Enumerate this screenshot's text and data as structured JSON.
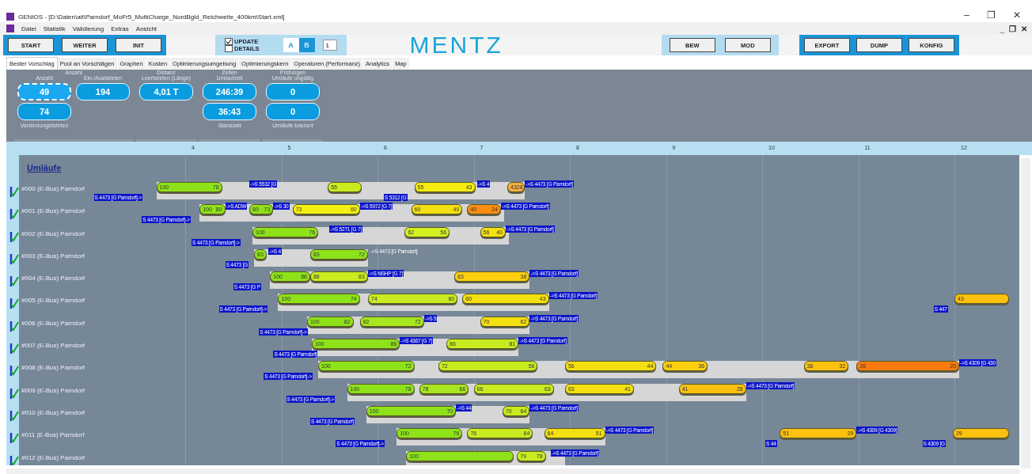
{
  "window": {
    "title": "GENIOS - [D:\\Daten\\ait\\Parndorf_MoFr5_MultiCharge_NordBgld_Reichweite_400km\\Start.xml]",
    "controls": [
      "–",
      "❐",
      "✕"
    ]
  },
  "menu": {
    "items": [
      "Datei",
      "Statistik",
      "Validierung",
      "Extras",
      "Ansicht"
    ],
    "controls": [
      "_",
      "❐",
      "✕"
    ]
  },
  "toolbar": {
    "left_buttons": [
      "START",
      "WEITER",
      "INIT"
    ],
    "checkboxes": [
      {
        "label": "UPDATE",
        "checked": true
      },
      {
        "label": "DETAILS",
        "checked": false
      }
    ],
    "toggle": [
      {
        "label": "A",
        "selected": false
      },
      {
        "label": "B",
        "selected": true
      }
    ],
    "spinner": "1",
    "logo": "MENTZ",
    "mid_buttons": [
      "BEW",
      "MOD"
    ],
    "right_buttons": [
      "EXPORT",
      "DUMP",
      "KONFIG"
    ]
  },
  "tabs": [
    {
      "label": "Bester Vorschlag",
      "selected": true
    },
    {
      "label": "Pool an Vorschlägen",
      "selected": false
    },
    {
      "label": "Graphen",
      "selected": false
    },
    {
      "label": "Kosten",
      "selected": false
    },
    {
      "label": "Optimierungsumgebung",
      "selected": false
    },
    {
      "label": "Optimierungskern",
      "selected": false
    },
    {
      "label": "Operatoren (Performanz)",
      "selected": false
    },
    {
      "label": "Analytics",
      "selected": false
    },
    {
      "label": "Map",
      "selected": false
    }
  ],
  "stats": [
    {
      "title": "Anzahl",
      "columns": [
        {
          "label": "Anzahl",
          "cards": [
            {
              "value": "49",
              "selected": true
            },
            {
              "value": "74",
              "selected": false
            }
          ],
          "caption": "Verbindungsfahrten"
        },
        {
          "label": "Ein-/Ausfahrten",
          "cards": [
            {
              "value": "194",
              "selected": false
            }
          ]
        }
      ]
    },
    {
      "title": "Distanz",
      "columns": [
        {
          "label": "Leerfahrten (Länge)",
          "cards": [
            {
              "value": "4,01 T",
              "selected": false
            }
          ]
        }
      ]
    },
    {
      "title": "Zeiten",
      "columns": [
        {
          "label": "Umlaufzeit",
          "cards": [
            {
              "value": "246:39",
              "selected": false
            },
            {
              "value": "36:43",
              "selected": false
            }
          ],
          "caption": "Standzeit"
        }
      ]
    },
    {
      "title": "Prüfungen",
      "columns": [
        {
          "label": "Umläufe ungültig",
          "cards": [
            {
              "value": "0",
              "selected": false
            },
            {
              "value": "0",
              "selected": false
            }
          ],
          "caption": "Umläufe toleriert"
        }
      ]
    }
  ],
  "timeline": {
    "hours": [
      "4",
      "5",
      "6",
      "7",
      "8",
      "9",
      "10",
      "11",
      "12"
    ]
  },
  "gantt": {
    "title": "Umläufe",
    "rows": [
      {
        "label": "#000 (E-Bus) Parndorf",
        "bars": [
          {
            "color": "#8ee21a",
            "from": "100",
            "to": "78"
          },
          {
            "color": "#c8ec20",
            "from": "55"
          },
          {
            "color": "#f4ec10",
            "from": "55",
            "to": "43"
          },
          {
            "color": "#f5b040",
            "from": "43",
            "to": "28"
          }
        ],
        "tags": [
          {
            "text": "S 4473 [G Parndorf]->",
            "kind": "blue"
          },
          {
            "text": "->S 5532 [G",
            "kind": "blue"
          },
          {
            "text": "S 5312 [G",
            "kind": "blue"
          },
          {
            "text": "->S 4",
            "kind": "blue"
          },
          {
            "text": "->S 4473 [G Parndorf]",
            "kind": "blue"
          }
        ]
      },
      {
        "label": "#001 (E-Bus) Parndorf",
        "bars": [
          {
            "color": "#8ee21a",
            "from": "100",
            "to": "80"
          },
          {
            "color": "#8ee21a",
            "from": "80",
            "to": "73"
          },
          {
            "color": "#f4f010",
            "from": "73",
            "to": "60"
          },
          {
            "color": "#f4e010",
            "from": "60",
            "to": "40"
          },
          {
            "color": "#fb8c10",
            "from": "40",
            "to": "24"
          }
        ],
        "tags": [
          {
            "text": "S 4473 [G Parndorf]->",
            "kind": "blue"
          },
          {
            "text": "->S ADW",
            "kind": "blue"
          },
          {
            "text": "->S 30",
            "kind": "blue"
          },
          {
            "text": "->S 5972 [G 7]",
            "kind": "blue"
          },
          {
            "text": "->S 4473 [G Parndorf]",
            "kind": "blue"
          }
        ]
      },
      {
        "label": "#002 (E-Bus) Parndorf",
        "bars": [
          {
            "color": "#8ee21a",
            "from": "100",
            "to": "76"
          },
          {
            "color": "#d4f020",
            "from": "62",
            "to": "56"
          },
          {
            "color": "#f4e010",
            "from": "56",
            "to": "40"
          }
        ],
        "tags": [
          {
            "text": "S 4473 [G Parndorf]->",
            "kind": "blue"
          },
          {
            "text": "->S 5271 [G 7]",
            "kind": "blue"
          },
          {
            "text": "->S 4473 [G Parndorf]",
            "kind": "blue"
          }
        ]
      },
      {
        "label": "#003 (E-Bus) Parndorf",
        "bars": [
          {
            "color": "#8ee21a",
            "from": "83"
          },
          {
            "color": "#8ee21a",
            "from": "83",
            "to": "72"
          }
        ],
        "tags": [
          {
            "text": "S 4473 [G",
            "kind": "blue"
          },
          {
            "text": "->S 4",
            "kind": "blue"
          },
          {
            "text": "->S 4473 [G Parndorf]",
            "kind": "plain"
          }
        ]
      },
      {
        "label": "#004 (E-Bus) Parndorf",
        "bars": [
          {
            "color": "#8ee21a",
            "from": "100",
            "to": "88"
          },
          {
            "color": "#c8ec20",
            "from": "88",
            "to": "83"
          },
          {
            "color": "#fcd010",
            "from": "63",
            "to": "38"
          }
        ],
        "tags": [
          {
            "text": "S 4473 [G P",
            "kind": "blue"
          },
          {
            "text": "->S NSHP [G 7]",
            "kind": "blue"
          },
          {
            "text": "->S 4473 [G Parndorf]",
            "kind": "blue"
          }
        ]
      },
      {
        "label": "#005 (E-Bus) Parndorf",
        "bars": [
          {
            "color": "#8ee21a",
            "from": "100",
            "to": "74"
          },
          {
            "color": "#c8ec20",
            "from": "74",
            "to": "60"
          },
          {
            "color": "#f4e010",
            "from": "60",
            "to": "43"
          },
          {
            "color": "#fcc010",
            "from": "43"
          }
        ],
        "tags": [
          {
            "text": "S 4473 [G Parndorf]->",
            "kind": "blue"
          },
          {
            "text": "->S 4473 [G Parndorf]",
            "kind": "blue"
          },
          {
            "text": "S 447",
            "kind": "blue"
          }
        ]
      },
      {
        "label": "#006 (E-Bus) Parndorf",
        "bars": [
          {
            "color": "#8ee21a",
            "from": "100",
            "to": "82"
          },
          {
            "color": "#a8e620",
            "from": "82",
            "to": "72"
          },
          {
            "color": "#f4e010",
            "from": "70",
            "to": "62"
          }
        ],
        "tags": [
          {
            "text": "S 4473 [G Parndorf]->",
            "kind": "blue"
          },
          {
            "text": "->S 5",
            "kind": "blue"
          },
          {
            "text": "->S 4473 [G Parndorf]",
            "kind": "blue"
          }
        ]
      },
      {
        "label": "#007 (E-Bus) Parndorf",
        "bars": [
          {
            "color": "#8ee21a",
            "from": "100",
            "to": "86"
          },
          {
            "color": "#c8ec20",
            "from": "86",
            "to": "81"
          }
        ],
        "tags": [
          {
            "text": "S 4473 [G Parndorf]",
            "kind": "blue"
          },
          {
            "text": "->S 4367 [G 7]",
            "kind": "blue"
          },
          {
            "text": "->S 4473 [G Parndorf]",
            "kind": "blue"
          }
        ]
      },
      {
        "label": "#008 (E-Bus) Parndorf",
        "bars": [
          {
            "color": "#8ee21a",
            "from": "100",
            "to": "72"
          },
          {
            "color": "#c8ec20",
            "from": "72",
            "to": "56"
          },
          {
            "color": "#f4e010",
            "from": "56",
            "to": "44"
          },
          {
            "color": "#fcd010",
            "from": "44",
            "to": "36"
          },
          {
            "color": "#fcc010",
            "from": "36",
            "to": "32"
          },
          {
            "color": "#fb7a10",
            "from": "26",
            "to": "20"
          }
        ],
        "tags": [
          {
            "text": "S 4473 [G Parndorf]->",
            "kind": "blue"
          },
          {
            "text": "->S 4309 [G 430",
            "kind": "blue"
          }
        ]
      },
      {
        "label": "#009 (E-Bus) Parndorf",
        "bars": [
          {
            "color": "#8ee21a",
            "from": "100",
            "to": "78"
          },
          {
            "color": "#a8e620",
            "from": "78",
            "to": "66"
          },
          {
            "color": "#c8ec20",
            "from": "66",
            "to": "63"
          },
          {
            "color": "#f4e010",
            "from": "63",
            "to": "41"
          },
          {
            "color": "#fcc010",
            "from": "41",
            "to": "28"
          }
        ],
        "tags": [
          {
            "text": "S 4473 [G Parndorf]->",
            "kind": "blue"
          },
          {
            "text": "->S 4473 [G Parndorf]",
            "kind": "blue"
          }
        ]
      },
      {
        "label": "#010 (E-Bus) Parndorf",
        "bars": [
          {
            "color": "#8ee21a",
            "from": "100",
            "to": "70"
          },
          {
            "color": "#c8ec20",
            "from": "70",
            "to": "64"
          }
        ],
        "tags": [
          {
            "text": "S 4473 [G Parndorf]",
            "kind": "blue"
          },
          {
            "text": "->S 44",
            "kind": "blue"
          },
          {
            "text": "->S 4473 [G Parndorf]",
            "kind": "blue"
          }
        ]
      },
      {
        "label": "#011 (E-Bus) Parndorf",
        "bars": [
          {
            "color": "#8ee21a",
            "from": "100",
            "to": "76"
          },
          {
            "color": "#c8ec20",
            "from": "76",
            "to": "64"
          },
          {
            "color": "#f4e010",
            "from": "64",
            "to": "51"
          },
          {
            "color": "#fcc010",
            "from": "51",
            "to": "29"
          },
          {
            "color": "#fcc010",
            "from": "29"
          }
        ],
        "tags": [
          {
            "text": "S 4473 [G Parndorf]->",
            "kind": "blue"
          },
          {
            "text": "->S 4473 [G Parndorf]",
            "kind": "blue"
          },
          {
            "text": "S 44",
            "kind": "blue"
          },
          {
            "text": "->S 4309 [G 4309]",
            "kind": "blue"
          },
          {
            "text": "S 4309 [G",
            "kind": "blue"
          }
        ]
      },
      {
        "label": "#012 (E-Bus) Parndorf",
        "bars": [
          {
            "color": "#8ee21a",
            "from": "100"
          },
          {
            "color": "#c8ec20",
            "from": "79",
            "to": "78"
          }
        ],
        "tags": [
          {
            "text": "->S 4473 [G Parndorf]",
            "kind": "blue"
          }
        ]
      }
    ]
  }
}
